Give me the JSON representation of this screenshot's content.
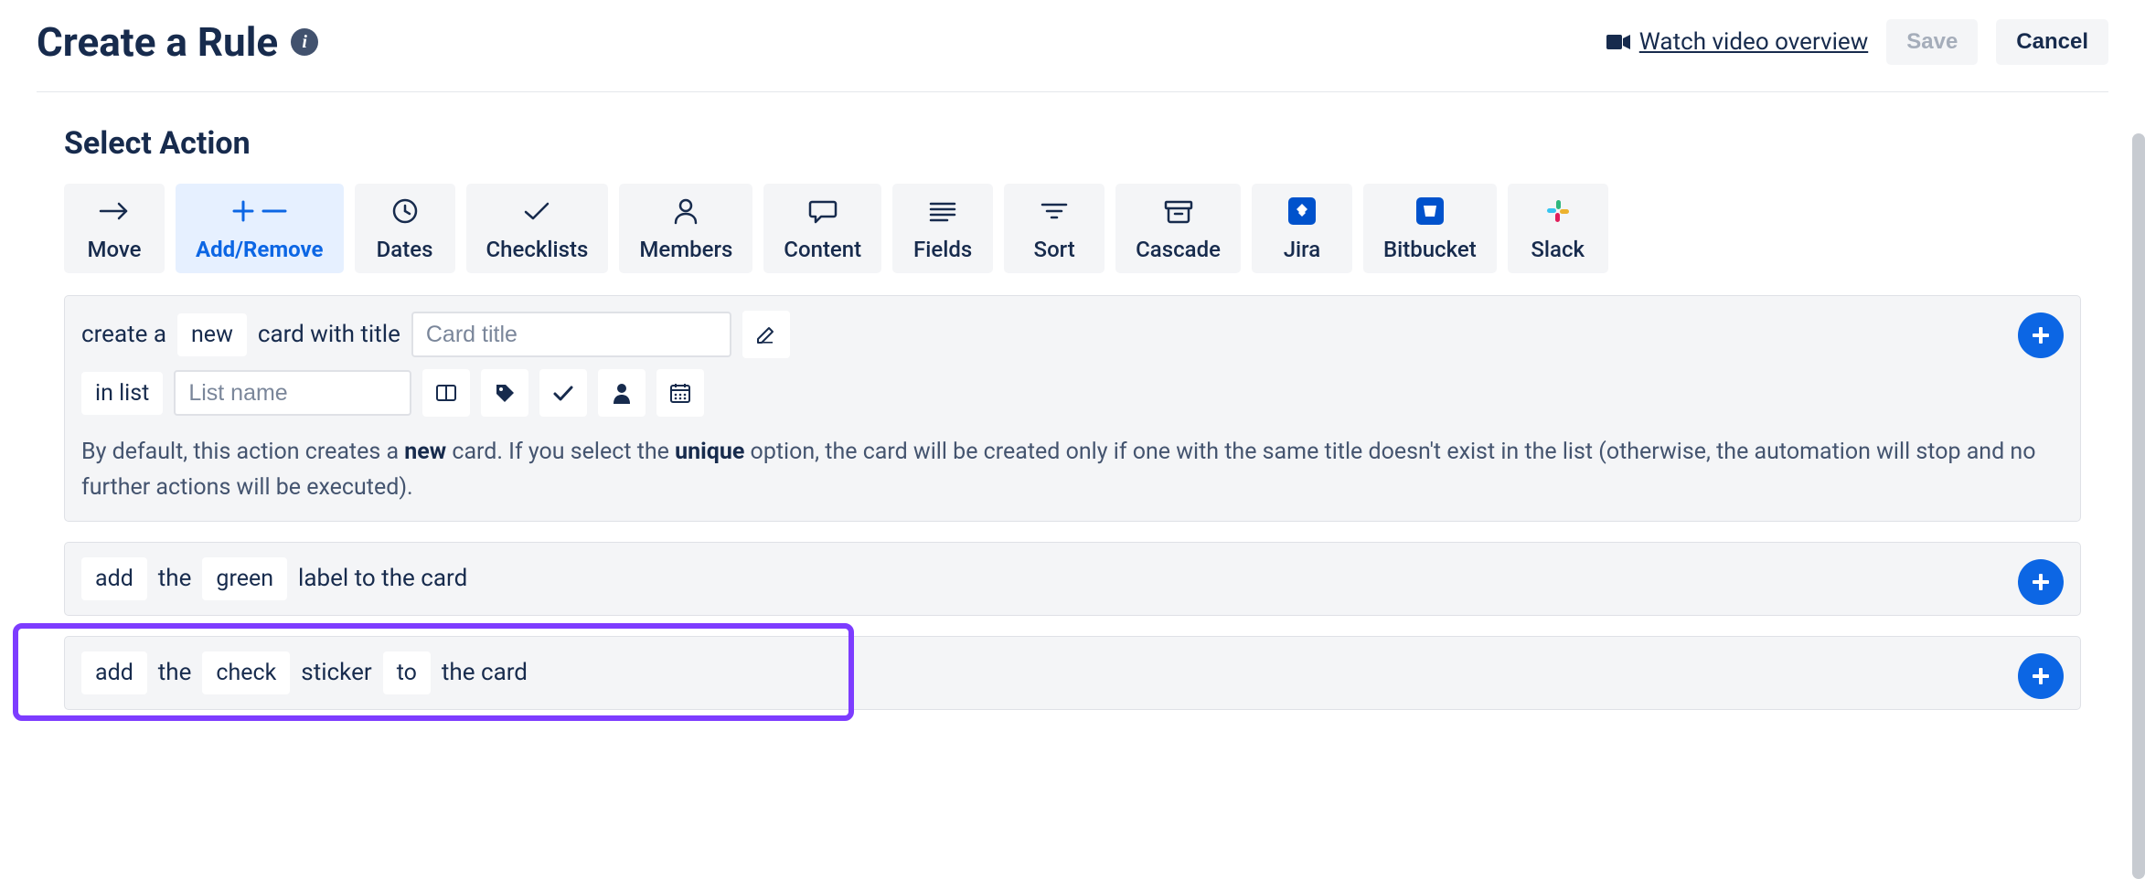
{
  "header": {
    "title": "Create a Rule",
    "video_link": "Watch video overview",
    "save_label": "Save",
    "cancel_label": "Cancel"
  },
  "section_title": "Select Action",
  "tabs": [
    {
      "label": "Move"
    },
    {
      "label": "Add/Remove"
    },
    {
      "label": "Dates"
    },
    {
      "label": "Checklists"
    },
    {
      "label": "Members"
    },
    {
      "label": "Content"
    },
    {
      "label": "Fields"
    },
    {
      "label": "Sort"
    },
    {
      "label": "Cascade"
    },
    {
      "label": "Jira"
    },
    {
      "label": "Bitbucket"
    },
    {
      "label": "Slack"
    }
  ],
  "card1": {
    "t_create_a": "create a",
    "chip_new": "new",
    "t_card_with_title": "card with title",
    "placeholder_card_title": "Card title",
    "t_in_list": "in list",
    "placeholder_list_name": "List name",
    "note_pre": "By default, this action creates a ",
    "note_b1": "new",
    "note_mid": " card. If you select the ",
    "note_b2": "unique",
    "note_post": " option, the card will be created only if one with the same title doesn't exist in the list (otherwise, the automation will stop and no further actions will be executed)."
  },
  "card2": {
    "chip_add": "add",
    "t_the": "the",
    "chip_green": "green",
    "t_label_to_card": "label to the card"
  },
  "card3": {
    "chip_add": "add",
    "t_the": "the",
    "chip_check": "check",
    "t_sticker": "sticker",
    "chip_to": "to",
    "t_the_card": "the card"
  }
}
